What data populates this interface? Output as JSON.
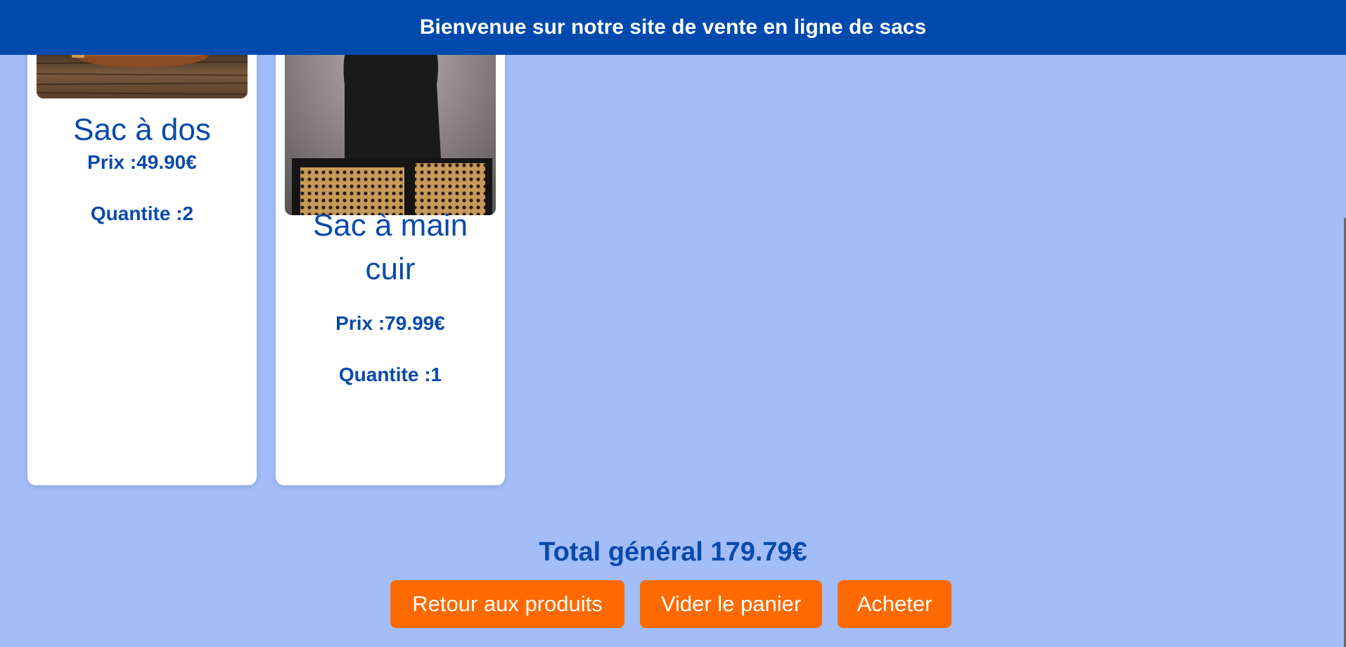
{
  "header": {
    "title": "Bienvenue sur notre site de vente en ligne de sacs"
  },
  "cart": {
    "items": [
      {
        "name": "Sac à dos",
        "price": "Prix :49.90€",
        "quantity": "Quantite :2",
        "image_icon": "leather-bag-photo"
      },
      {
        "name": "Sac à main cuir",
        "price": "Prix :79.99€",
        "quantity": "Quantite :1",
        "image_icon": "black-handbag-photo"
      }
    ],
    "total": "Total général 179.79€"
  },
  "actions": {
    "back_label": "Retour aux produits",
    "empty_label": "Vider le panier",
    "buy_label": "Acheter"
  },
  "colors": {
    "header_bg": "#004aad",
    "page_bg": "#a2bdf7",
    "accent_button": "#ff6a00",
    "text_blue": "#0a4aab"
  }
}
